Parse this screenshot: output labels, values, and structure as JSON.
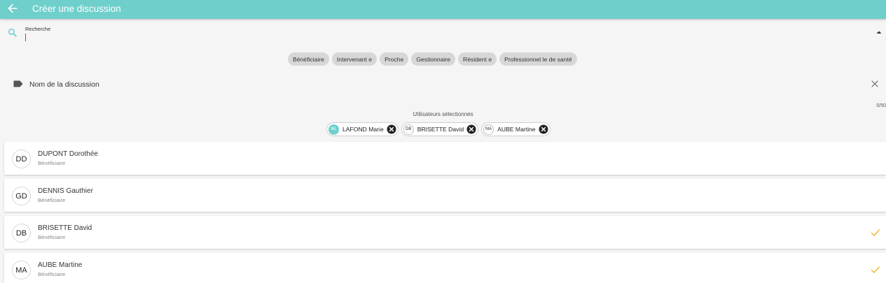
{
  "header": {
    "title": "Créer une discussion"
  },
  "search": {
    "label": "Recherche",
    "value": ""
  },
  "filters": [
    "Bénéficiaire",
    "Intervenant e",
    "Proche",
    "Gestionnaire",
    "Résident e",
    "Professionnel le de santé"
  ],
  "discussion_name": {
    "placeholder": "Nom de la discussion",
    "counter": "0/50"
  },
  "selected": {
    "title": "Utilisateurs sélectionnés",
    "users": [
      {
        "initials": "ML",
        "name": "LAFOND Marie",
        "highlighted": true
      },
      {
        "initials": "DB",
        "name": "BRISETTE David",
        "highlighted": false
      },
      {
        "initials": "MA",
        "name": "AUBE Martine",
        "highlighted": false
      }
    ]
  },
  "users": [
    {
      "initials": "DD",
      "name": "DUPONT Dorothée",
      "role": "Bénéficiaire",
      "checked": false
    },
    {
      "initials": "GD",
      "name": "DENNIS Gauthier",
      "role": "Bénéficiaire",
      "checked": false
    },
    {
      "initials": "DB",
      "name": "BRISETTE David",
      "role": "Bénéficiaire",
      "checked": true
    },
    {
      "initials": "MA",
      "name": "AUBE Martine",
      "role": "Bénéficiaire",
      "checked": true
    }
  ],
  "colors": {
    "header": "#6fcfcb",
    "check": "#f0b429",
    "search_icon": "#6fcfcb"
  }
}
